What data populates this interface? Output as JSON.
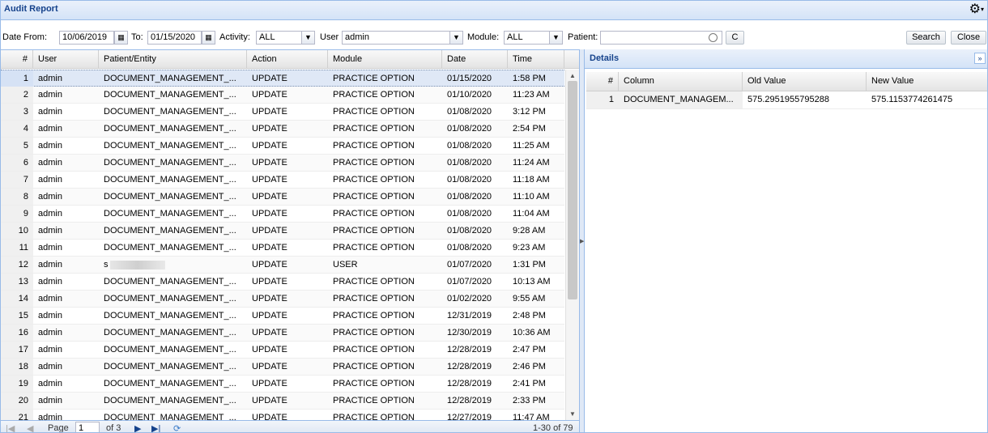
{
  "window": {
    "title": "Audit Report"
  },
  "filters": {
    "date_from_label": "Date From:",
    "date_from_value": "10/06/2019",
    "to_label": "To:",
    "to_value": "01/15/2020",
    "activity_label": "Activity:",
    "activity_value": "ALL",
    "user_label": "User",
    "user_value": "admin",
    "module_label": "Module:",
    "module_value": "ALL",
    "patient_label": "Patient:",
    "patient_value": "",
    "clear_label": "C",
    "search_label": "Search",
    "close_label": "Close"
  },
  "grid": {
    "columns": [
      "#",
      "User",
      "Patient/Entity",
      "Action",
      "Module",
      "Date",
      "Time"
    ],
    "rows": [
      [
        "1",
        "admin",
        "DOCUMENT_MANAGEMENT_...",
        "UPDATE",
        "PRACTICE OPTION",
        "01/15/2020",
        "1:58 PM"
      ],
      [
        "2",
        "admin",
        "DOCUMENT_MANAGEMENT_...",
        "UPDATE",
        "PRACTICE OPTION",
        "01/10/2020",
        "11:23 AM"
      ],
      [
        "3",
        "admin",
        "DOCUMENT_MANAGEMENT_...",
        "UPDATE",
        "PRACTICE OPTION",
        "01/08/2020",
        "3:12 PM"
      ],
      [
        "4",
        "admin",
        "DOCUMENT_MANAGEMENT_...",
        "UPDATE",
        "PRACTICE OPTION",
        "01/08/2020",
        "2:54 PM"
      ],
      [
        "5",
        "admin",
        "DOCUMENT_MANAGEMENT_...",
        "UPDATE",
        "PRACTICE OPTION",
        "01/08/2020",
        "11:25 AM"
      ],
      [
        "6",
        "admin",
        "DOCUMENT_MANAGEMENT_...",
        "UPDATE",
        "PRACTICE OPTION",
        "01/08/2020",
        "11:24 AM"
      ],
      [
        "7",
        "admin",
        "DOCUMENT_MANAGEMENT_...",
        "UPDATE",
        "PRACTICE OPTION",
        "01/08/2020",
        "11:18 AM"
      ],
      [
        "8",
        "admin",
        "DOCUMENT_MANAGEMENT_...",
        "UPDATE",
        "PRACTICE OPTION",
        "01/08/2020",
        "11:10 AM"
      ],
      [
        "9",
        "admin",
        "DOCUMENT_MANAGEMENT_...",
        "UPDATE",
        "PRACTICE OPTION",
        "01/08/2020",
        "11:04 AM"
      ],
      [
        "10",
        "admin",
        "DOCUMENT_MANAGEMENT_...",
        "UPDATE",
        "PRACTICE OPTION",
        "01/08/2020",
        "9:28 AM"
      ],
      [
        "11",
        "admin",
        "DOCUMENT_MANAGEMENT_...",
        "UPDATE",
        "PRACTICE OPTION",
        "01/08/2020",
        "9:23 AM"
      ],
      [
        "12",
        "admin",
        "s",
        "UPDATE",
        "USER",
        "01/07/2020",
        "1:31 PM"
      ],
      [
        "13",
        "admin",
        "DOCUMENT_MANAGEMENT_...",
        "UPDATE",
        "PRACTICE OPTION",
        "01/07/2020",
        "10:13 AM"
      ],
      [
        "14",
        "admin",
        "DOCUMENT_MANAGEMENT_...",
        "UPDATE",
        "PRACTICE OPTION",
        "01/02/2020",
        "9:55 AM"
      ],
      [
        "15",
        "admin",
        "DOCUMENT_MANAGEMENT_...",
        "UPDATE",
        "PRACTICE OPTION",
        "12/31/2019",
        "2:48 PM"
      ],
      [
        "16",
        "admin",
        "DOCUMENT_MANAGEMENT_...",
        "UPDATE",
        "PRACTICE OPTION",
        "12/30/2019",
        "10:36 AM"
      ],
      [
        "17",
        "admin",
        "DOCUMENT_MANAGEMENT_...",
        "UPDATE",
        "PRACTICE OPTION",
        "12/28/2019",
        "2:47 PM"
      ],
      [
        "18",
        "admin",
        "DOCUMENT_MANAGEMENT_...",
        "UPDATE",
        "PRACTICE OPTION",
        "12/28/2019",
        "2:46 PM"
      ],
      [
        "19",
        "admin",
        "DOCUMENT_MANAGEMENT_...",
        "UPDATE",
        "PRACTICE OPTION",
        "12/28/2019",
        "2:41 PM"
      ],
      [
        "20",
        "admin",
        "DOCUMENT_MANAGEMENT_...",
        "UPDATE",
        "PRACTICE OPTION",
        "12/28/2019",
        "2:33 PM"
      ],
      [
        "21",
        "admin",
        "DOCUMENT_MANAGEMENT_...",
        "UPDATE",
        "PRACTICE OPTION",
        "12/27/2019",
        "11:47 AM"
      ]
    ],
    "selected_row": 0
  },
  "pager": {
    "page_label": "Page",
    "page_value": "1",
    "of_label": "of 3",
    "summary": "1-30 of 79"
  },
  "details": {
    "title": "Details",
    "columns": [
      "#",
      "Column",
      "Old Value",
      "New Value"
    ],
    "rows": [
      [
        "1",
        "DOCUMENT_MANAGEM...",
        "575.2951955795288",
        "575.1153774261475"
      ]
    ]
  },
  "icons": {
    "gear": "gear-icon",
    "calendar": "calendar-icon",
    "dropdown": "chevron-down-icon",
    "refresh": "refresh-icon",
    "collapse": "double-chevron-right-icon"
  }
}
